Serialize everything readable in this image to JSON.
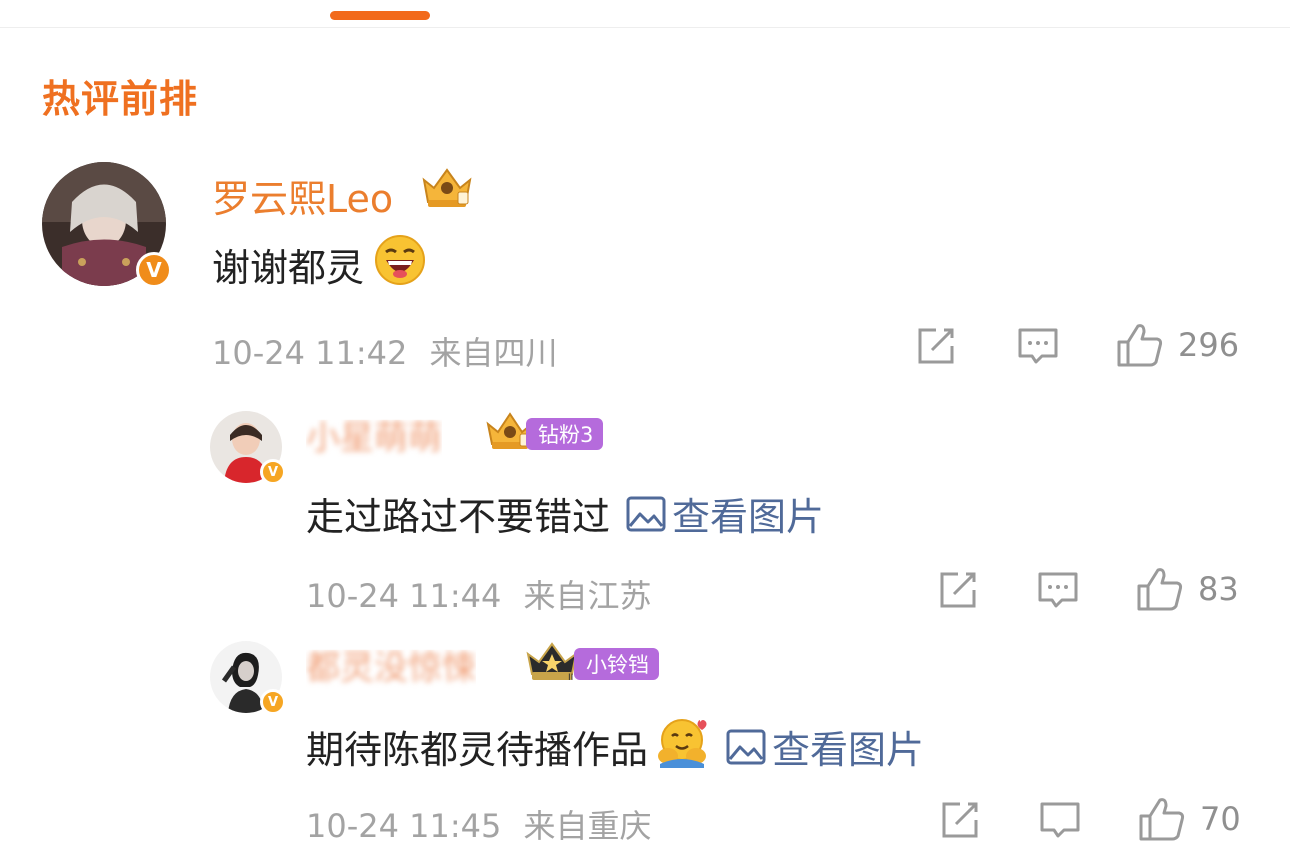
{
  "section_title": "热评前排",
  "comments": [
    {
      "username": "罗云熙Leo",
      "content": "谢谢都灵",
      "emoji": "laughing-emoji",
      "time": "10-24 11:42",
      "location": "来自四川",
      "likes": "296",
      "verified": true
    },
    {
      "username": "小星萌萌",
      "fan_badge": "钻粉3",
      "content": "走过路过不要错过",
      "view_pic": "查看图片",
      "time": "10-24 11:44",
      "location": "来自江苏",
      "likes": "83",
      "verified": true
    },
    {
      "username": "都灵没惊悚",
      "fan_badge": "小铃铛",
      "content": "期待陈都灵待播作品",
      "emoji": "hugging-emoji",
      "view_pic": "查看图片",
      "time": "10-24 11:45",
      "location": "来自重庆",
      "likes": "70",
      "verified": true
    }
  ],
  "colors": {
    "accent": "#ef7020",
    "username": "#eb7e2e",
    "link": "#506a99",
    "meta": "#a3a3a3",
    "fan_badge": "#b56bdc"
  }
}
